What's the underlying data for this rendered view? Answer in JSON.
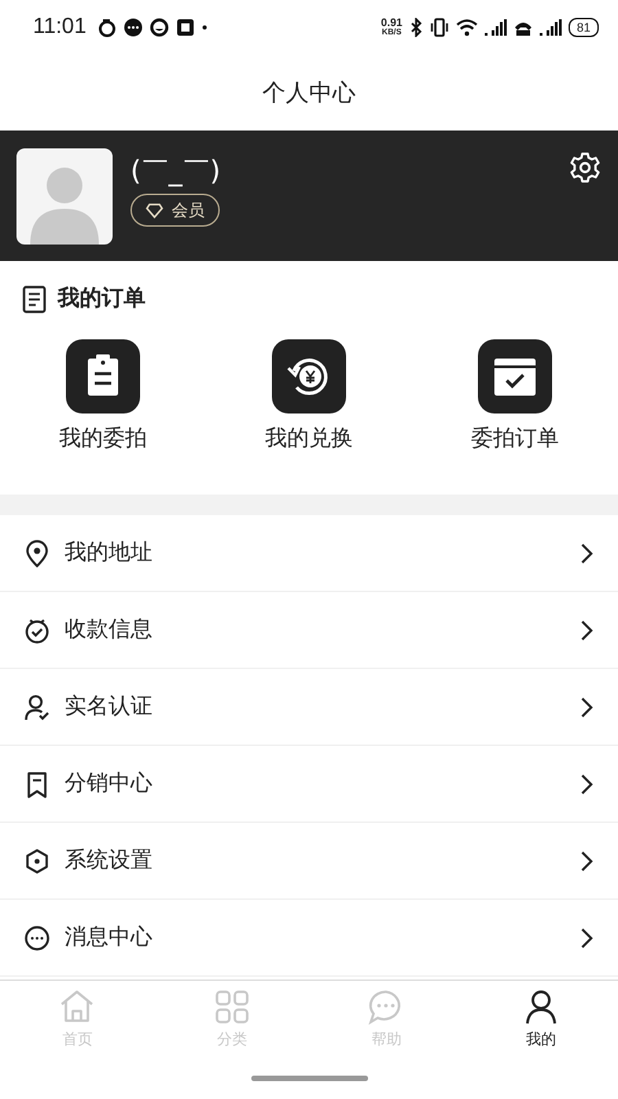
{
  "status_bar": {
    "time": "11:01",
    "net_speed": "0.91",
    "net_unit": "KB/S",
    "battery": "81"
  },
  "title": "个人中心",
  "profile": {
    "username": "(￣_￣)",
    "badge": "会员"
  },
  "orders": {
    "title": "我的订单",
    "items": [
      {
        "kind": "clipboard",
        "label": "我的委拍"
      },
      {
        "kind": "exchange",
        "label": "我的兑换"
      },
      {
        "kind": "calendar",
        "label": "委拍订单"
      }
    ]
  },
  "menu": [
    {
      "kind": "location",
      "label": "我的地址"
    },
    {
      "kind": "wallet",
      "label": "收款信息"
    },
    {
      "kind": "verify",
      "label": "实名认证"
    },
    {
      "kind": "bookmark",
      "label": "分销中心"
    },
    {
      "kind": "hexagon",
      "label": "系统设置"
    },
    {
      "kind": "message",
      "label": "消息中心"
    }
  ],
  "tabs": [
    {
      "kind": "home",
      "label": "首页",
      "selected": false
    },
    {
      "kind": "grid",
      "label": "分类",
      "selected": false
    },
    {
      "kind": "chat",
      "label": "帮助",
      "selected": false
    },
    {
      "kind": "user",
      "label": "我的",
      "selected": true
    }
  ]
}
